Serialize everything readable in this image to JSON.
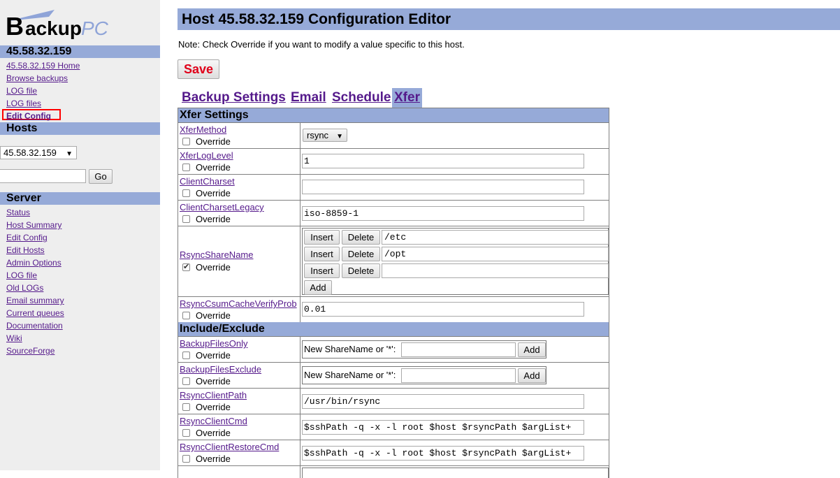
{
  "logo": {
    "text_main": "BackupPC",
    "b": "B",
    "ackup": "ackup",
    "pc": "PC"
  },
  "host_nav": {
    "header": "45.58.32.159",
    "links": [
      "45.58.32.159 Home",
      "Browse backups",
      "LOG file",
      "LOG files",
      "Edit Config"
    ]
  },
  "hosts": {
    "header": "Hosts",
    "selected": "45.58.32.159",
    "search_value": "",
    "go_label": "Go"
  },
  "server": {
    "header": "Server",
    "links": [
      "Status",
      "Host Summary",
      "Edit Config",
      "Edit Hosts",
      "Admin Options",
      "LOG file",
      "Old LOGs",
      "Email summary",
      "Current queues",
      "Documentation",
      "Wiki",
      "SourceForge"
    ]
  },
  "page": {
    "title": "Host 45.58.32.159 Configuration Editor",
    "note": "Note: Check Override if you want to modify a value specific to this host.",
    "save_label": "Save"
  },
  "tabs": [
    "Backup Settings",
    "Email",
    "Schedule",
    "Xfer"
  ],
  "override_label": "Override",
  "sections": {
    "xfer": "Xfer Settings",
    "include": "Include/Exclude"
  },
  "params": {
    "xfer_method": {
      "name": "XferMethod",
      "value": "rsync",
      "override": false
    },
    "xfer_log_level": {
      "name": "XferLogLevel",
      "value": "1",
      "override": false
    },
    "client_charset": {
      "name": "ClientCharset",
      "value": "",
      "override": false
    },
    "client_charset_legacy": {
      "name": "ClientCharsetLegacy",
      "value": "iso-8859-1",
      "override": false
    },
    "rsync_share_name": {
      "name": "RsyncShareName",
      "override": true,
      "entries": [
        "/etc",
        "/opt",
        ""
      ],
      "insert_label": "Insert",
      "delete_label": "Delete",
      "add_label": "Add"
    },
    "rsync_csum": {
      "name": "RsyncCsumCacheVerifyProb",
      "value": "0.01",
      "override": false
    },
    "backup_files_only": {
      "name": "BackupFilesOnly",
      "share_label": "New ShareName or '*':",
      "add_label": "Add",
      "override": false
    },
    "backup_files_exclude": {
      "name": "BackupFilesExclude",
      "share_label": "New ShareName or '*':",
      "add_label": "Add",
      "override": false
    },
    "rsync_client_path": {
      "name": "RsyncClientPath",
      "value": "/usr/bin/rsync",
      "override": false
    },
    "rsync_client_cmd": {
      "name": "RsyncClientCmd",
      "value": "$sshPath -q -x -l root $host $rsyncPath $argList+",
      "override": false
    },
    "rsync_client_restore_cmd": {
      "name": "RsyncClientRestoreCmd",
      "value": "$sshPath -q -x -l root $host $rsyncPath $argList+",
      "override": false
    }
  },
  "colors": {
    "header_bg": "#96aad8",
    "sidebar_bg": "#eeeeee",
    "link": "#551a8b",
    "save_text": "#e0001a",
    "highlight": "#ff0000"
  }
}
